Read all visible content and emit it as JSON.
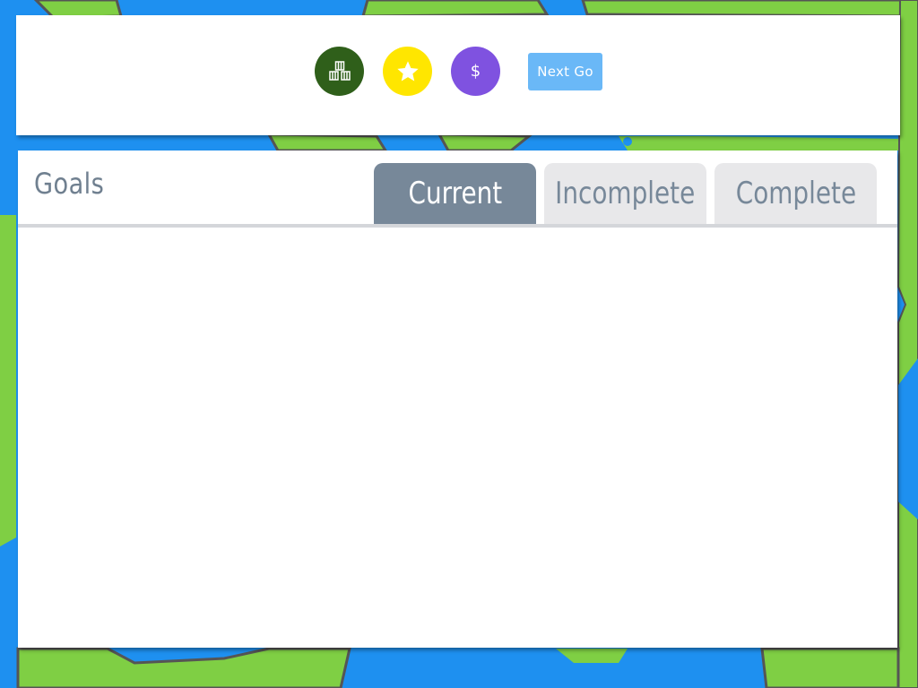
{
  "colors": {
    "ocean": "#1e90f0",
    "land": "#7fcf44",
    "border": "#555555",
    "buildings_button": "#2f5f1a",
    "stars_button": "#ffe600",
    "money_button": "#7f52e0",
    "next_go_button": "#6ab8f7",
    "tab_active": "#778899",
    "tab_inactive": "#e8e8ea"
  },
  "toolbar": {
    "buildings_icon": "buildings-icon",
    "stars_icon": "star-icon",
    "money_label": "$",
    "next_go_label": "Next Go"
  },
  "goals": {
    "title": "Goals",
    "tabs": [
      {
        "label": "Current",
        "active": true
      },
      {
        "label": "Incomplete",
        "active": false
      },
      {
        "label": "Complete",
        "active": false
      }
    ],
    "items": []
  }
}
